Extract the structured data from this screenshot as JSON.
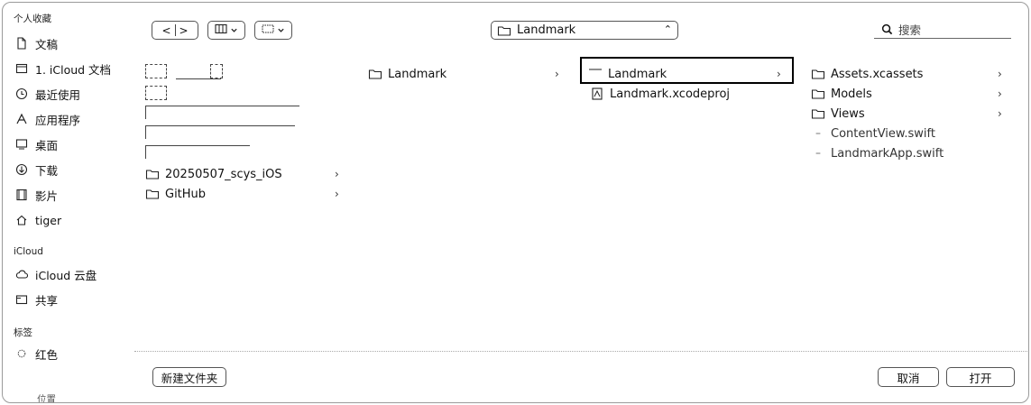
{
  "sidebar": {
    "section_favorites": "个人收藏",
    "favorites": [
      {
        "label": "文稿",
        "icon": "document-icon"
      },
      {
        "label": "1. iCloud 文档",
        "icon": "folder-icon"
      },
      {
        "label": "最近使用",
        "icon": "clock-icon"
      },
      {
        "label": "应用程序",
        "icon": "apps-icon"
      },
      {
        "label": "桌面",
        "icon": "desktop-icon"
      },
      {
        "label": "下载",
        "icon": "download-icon"
      },
      {
        "label": "影片",
        "icon": "film-icon"
      },
      {
        "label": "tiger",
        "icon": "home-icon"
      }
    ],
    "section_icloud": "iCloud",
    "icloud": [
      {
        "label": "iCloud 云盘",
        "icon": "cloud-icon"
      },
      {
        "label": "共享",
        "icon": "shared-folder-icon"
      }
    ],
    "section_tags": "标签",
    "tags": [
      {
        "label": "红色",
        "color": "#e03a3a"
      }
    ],
    "section_partial": "位置"
  },
  "toolbar": {
    "back": "<",
    "forward": ">",
    "path_title": "Landmark",
    "search_placeholder": "搜索"
  },
  "columns": {
    "col1": {
      "items": [
        {
          "label": "20250507_scys_iOS",
          "has_children": true
        },
        {
          "label": "GitHub",
          "has_children": true
        }
      ]
    },
    "col2": {
      "items": [
        {
          "label": "Landmark",
          "has_children": true
        }
      ]
    },
    "col3": {
      "items": [
        {
          "label": "Landmark",
          "has_children": true,
          "selected": true
        },
        {
          "label": "Landmark.xcodeproj",
          "has_children": false
        }
      ]
    },
    "col4": {
      "items": [
        {
          "label": "Assets.xcassets",
          "has_children": true
        },
        {
          "label": "Models",
          "has_children": true
        },
        {
          "label": "Views",
          "has_children": true
        },
        {
          "label": "ContentView.swift",
          "has_children": false
        },
        {
          "label": "LandmarkApp.swift",
          "has_children": false
        }
      ]
    }
  },
  "footer": {
    "new_folder": "新建文件夹",
    "cancel": "取消",
    "open": "打开"
  }
}
